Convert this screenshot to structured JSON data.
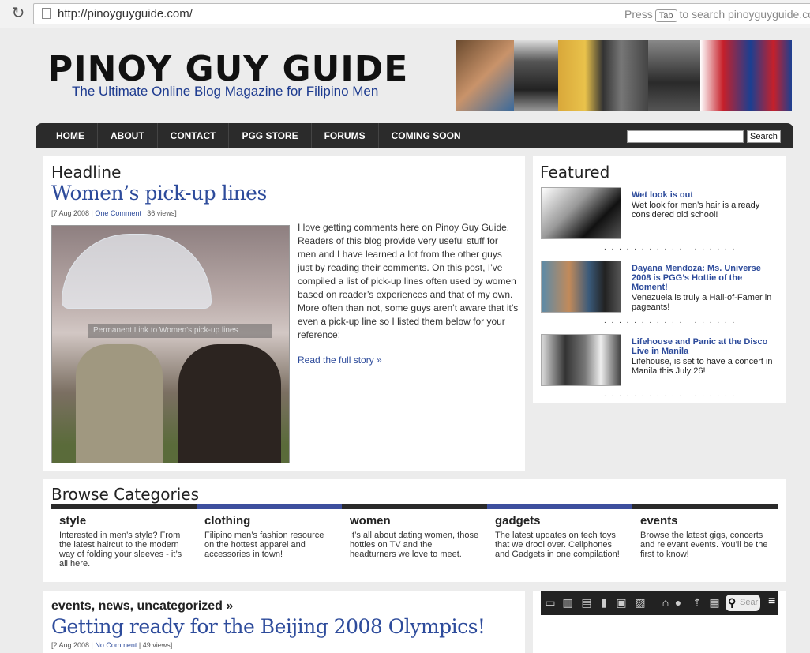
{
  "browser": {
    "url": "http://pinoyguyguide.com/",
    "hint_press": "Press",
    "hint_key": "Tab",
    "hint_rest": "to search pinoyguyguide.co"
  },
  "header": {
    "logo": "PINOY GUY GUIDE",
    "tagline": "The Ultimate Online Blog Magazine for Filipino Men"
  },
  "nav": {
    "items": [
      "HOME",
      "ABOUT",
      "CONTACT",
      "PGG STORE",
      "FORUMS",
      "COMING SOON"
    ],
    "search_button": "Search"
  },
  "headline": {
    "section": "Headline",
    "title": "Women’s pick-up lines",
    "meta_date": "[7 Aug 2008 | ",
    "meta_comments": "One Comment",
    "meta_views": " | 36 views]",
    "caption": "Permanent Link to Women's pick-up lines",
    "excerpt": "I love getting comments here on Pinoy Guy Guide. Readers of this blog provide very useful stuff for men and I have learned a lot from the other guys just by reading their comments. On this post, I’ve compiled a list of pick-up lines often used by women based on reader’s experiences and that of my own. More often than not, some guys aren’t aware that it’s even a pick-up line so I listed them below for your reference:",
    "read_more": "Read the full story »"
  },
  "featured": {
    "section": "Featured",
    "items": [
      {
        "title": "Wet look is out",
        "desc": "Wet look for men’s hair is already considered old school!"
      },
      {
        "title": "Dayana Mendoza: Ms. Universe 2008 is PGG’s Hottie of the Moment!",
        "desc": "Venezuela is truly a Hall-of-Famer in pageants!"
      },
      {
        "title": "Lifehouse and Panic at the Disco Live in Manila",
        "desc": "Lifehouse, is set to have a concert in Manila this July 26!"
      }
    ],
    "dots": ". . . . . . . . . . . . . . . . . ."
  },
  "browse": {
    "section": "Browse Categories",
    "colors": [
      "#2a2a2a",
      "#3d4f9e",
      "#2a2a2a",
      "#3d4f9e",
      "#2a2a2a"
    ],
    "categories": [
      {
        "name": "style",
        "desc": "Interested in men’s style? From the latest haircut to the modern way of folding your sleeves - it’s all here."
      },
      {
        "name": "clothing",
        "desc": "Filipino men’s fashion resource on the hottest apparel and accessories in town!"
      },
      {
        "name": "women",
        "desc": "It’s all about dating women, those hotties on TV and the headturners we love to meet."
      },
      {
        "name": "gadgets",
        "desc": "The latest updates on tech toys that we drool over. Cellphones and Gadgets in one compilation!"
      },
      {
        "name": "events",
        "desc": "Browse the latest gigs, concerts and relevant events. You’ll be the first to know!"
      }
    ]
  },
  "post": {
    "categories": "events, news, uncategorized »",
    "title": "Getting ready for the Beijing 2008 Olympics!",
    "meta_date": "[2 Aug 2008 | ",
    "meta_comments": "No Comment",
    "meta_views": " | 49 views]"
  },
  "widget": {
    "search_placeholder": "Sear"
  }
}
